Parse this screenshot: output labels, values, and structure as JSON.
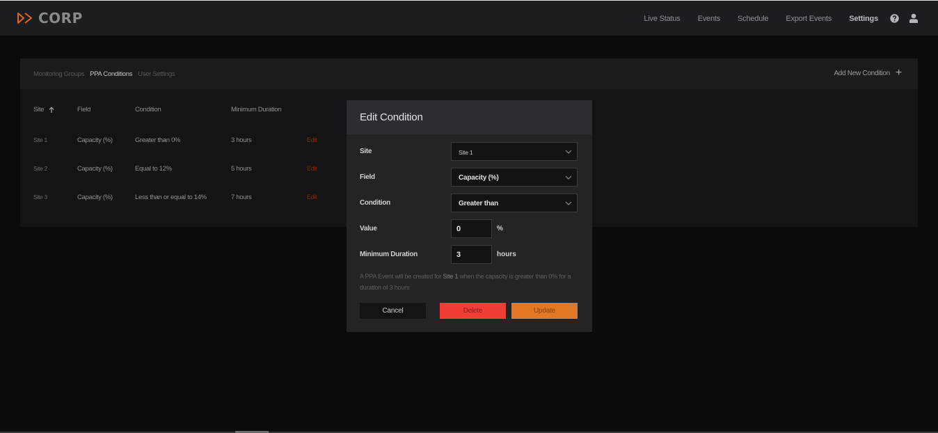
{
  "app": {
    "brand": "CORP",
    "accent_color": "#d9691e"
  },
  "nav": {
    "items": [
      {
        "label": "Live Status",
        "active": false
      },
      {
        "label": "Events",
        "active": false
      },
      {
        "label": "Schedule",
        "active": false
      },
      {
        "label": "Export Events",
        "active": false
      },
      {
        "label": "Settings",
        "active": true
      }
    ],
    "help_icon": "question-circle-icon",
    "user_icon": "user-icon"
  },
  "settings": {
    "tabs": [
      {
        "label": "Monitoring Groups",
        "active": false
      },
      {
        "label": "PPA Conditions",
        "active": true
      },
      {
        "label": "User Settings",
        "active": false
      }
    ],
    "add_button": "Add New Condition",
    "table": {
      "headers": {
        "site": "Site",
        "field": "Field",
        "condition": "Condition",
        "minimum_duration": "Minimum Duration"
      },
      "sort_indicator": "arrow-up",
      "rows": [
        {
          "site": "Site 1",
          "field": "Capacity (%)",
          "condition": "Greater than 0%",
          "duration": "3 hours",
          "action": "Edit"
        },
        {
          "site": "Site 2",
          "field": "Capacity (%)",
          "condition": "Equal to 12%",
          "duration": "5 hours",
          "action": "Edit"
        },
        {
          "site": "Site 3",
          "field": "Capacity (%)",
          "condition": "Less than or equal to 14%",
          "duration": "7 hours",
          "action": "Edit"
        }
      ]
    }
  },
  "modal": {
    "title": "Edit Condition",
    "fields": {
      "site": {
        "label": "Site",
        "value": "Site 1"
      },
      "field": {
        "label": "Field",
        "value": "Capacity (%)"
      },
      "condition": {
        "label": "Condition",
        "value": "Greater than"
      },
      "value": {
        "label": "Value",
        "value": "0",
        "unit": "%"
      },
      "duration": {
        "label": "Minimum Duration",
        "value": "3",
        "unit": "hours"
      }
    },
    "helper": {
      "prefix": "A PPA Event will be created for ",
      "site": "Site 1",
      "suffix": " when the capacity is greater than 0% for a duration of 3 hours"
    },
    "buttons": {
      "cancel": "Cancel",
      "delete": "Delete",
      "update": "Update"
    }
  }
}
